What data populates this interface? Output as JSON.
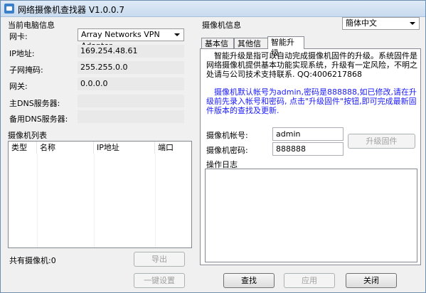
{
  "window": {
    "title": "网络摄像机查找器 V1.0.0.7"
  },
  "pc_info": {
    "heading": "当前电脑信息",
    "nic_label": "网卡:",
    "nic_value": "Array Networks VPN Adapter",
    "ip_label": "IP地址:",
    "ip_value": "169.254.48.61",
    "mask_label": "子网掩码:",
    "mask_value": "255.255.0.0",
    "gateway_label": "网关:",
    "gateway_value": "0.0.0.0",
    "dns1_label": "主DNS服务器:",
    "dns1_value": "",
    "dns2_label": "备用DNS服务器:",
    "dns2_value": ""
  },
  "camera_list": {
    "heading": "摄像机列表",
    "columns": [
      "类型",
      "名称",
      "IP地址",
      "端口"
    ],
    "count_label": "共有摄像机:0",
    "export_label": "导出"
  },
  "camera_info": {
    "heading": "摄像机信息",
    "language": "簡体中文",
    "tabs": [
      "基本信息",
      "其他信息",
      "智能升级"
    ],
    "desc_black": "智能升级是指可以自动完成摄像机固件的升级。系统固件是网络摄像机提供基本功能实现系统，升级有一定风险，不明之处请与公司技术支持联系. QQ:4006217868",
    "desc_blue": "摄像机默认帐号为admin,密码是888888,如已修改,请在升级前先录入帐号和密码, 点击\"升级固件\"按钮,即可完成最新固件版本的查找及更新.",
    "account_label": "摄像机帐号:",
    "account_value": "admin",
    "password_label": "摄像机密码:",
    "password_value": "888888",
    "upgrade_label": "升级固件",
    "log_label": "操作日志"
  },
  "footer": {
    "onekey_label": "一键设置",
    "search_label": "查找",
    "apply_label": "应用",
    "close_label": "关闭"
  }
}
